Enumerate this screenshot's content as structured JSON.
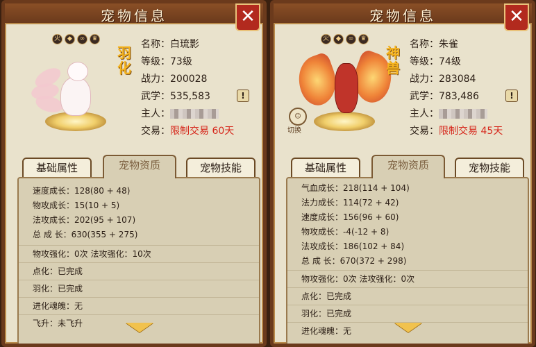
{
  "left": {
    "title": "宠物信息",
    "pet_type": "羽化",
    "element_icons": [
      "火",
      "◆",
      "∞",
      "♛"
    ],
    "info": [
      {
        "label": "名称：",
        "value": "白琉影"
      },
      {
        "label": "等级：",
        "value": "73级"
      },
      {
        "label": "战力：",
        "value": "200028"
      },
      {
        "label": "武学：",
        "value": "535,583"
      },
      {
        "label": "主人：",
        "value": ""
      },
      {
        "label": "交易：",
        "value": "限制交易 60天"
      }
    ],
    "tabs": [
      "基础属性",
      "宠物资质",
      "宠物技能"
    ],
    "growth": [
      "速度成长：128(80 + 48)",
      "物攻成长：15(10 + 5)",
      "法攻成长：202(95 + 107)",
      "总 成 长：630(355 + 275)"
    ],
    "enhance": {
      "phys": "物攻强化：0次",
      "magic": "法攻强化：10次"
    },
    "status": [
      "点化：已完成",
      "羽化：已完成",
      "进化魂魄：无",
      "飞升：未飞升"
    ]
  },
  "right": {
    "title": "宠物信息",
    "pet_type": "神兽",
    "swap_label": "切换",
    "element_icons": [
      "火",
      "◆",
      "∞",
      "♛"
    ],
    "info": [
      {
        "label": "名称：",
        "value": "朱雀"
      },
      {
        "label": "等级：",
        "value": "74级"
      },
      {
        "label": "战力：",
        "value": "283084"
      },
      {
        "label": "武学：",
        "value": "783,486"
      },
      {
        "label": "主人：",
        "value": ""
      },
      {
        "label": "交易：",
        "value": "限制交易 45天"
      }
    ],
    "tabs": [
      "基础属性",
      "宠物资质",
      "宠物技能"
    ],
    "growth": [
      "气血成长：218(114 + 104)",
      "法力成长：114(72 + 42)",
      "速度成长：156(96 + 60)",
      "物攻成长：-4(-12 + 8)",
      "法攻成长：186(102 + 84)",
      "总 成 长：670(372 + 298)"
    ],
    "enhance": {
      "phys": "物攻强化：0次",
      "magic": "法攻强化：0次"
    },
    "status": [
      "点化：已完成",
      "羽化：已完成",
      "进化魂魄：无"
    ]
  },
  "colors": {
    "accent_red": "#d6271b",
    "pet_type_gold": "#f6b41f",
    "frame_brown": "#6b3a1c"
  }
}
